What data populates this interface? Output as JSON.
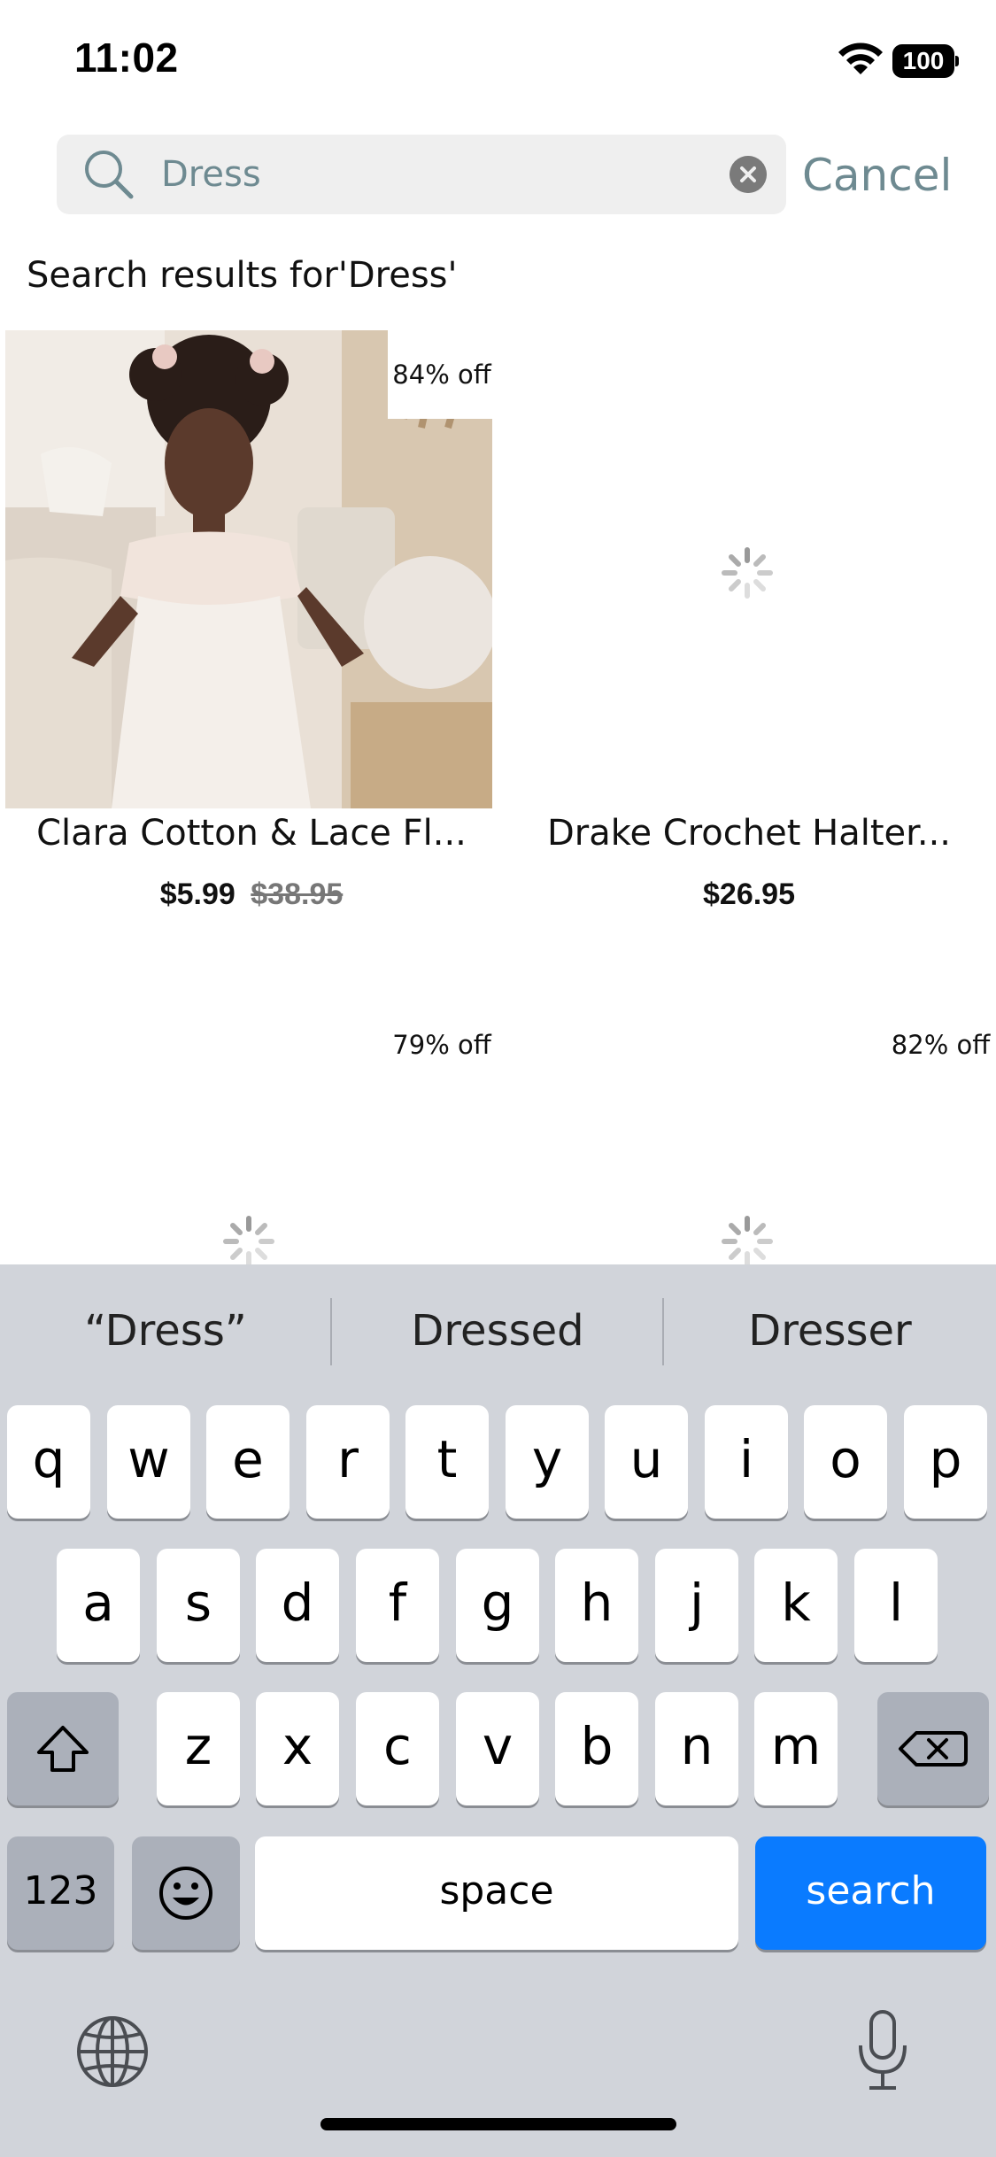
{
  "status_bar": {
    "time": "11:02",
    "battery": "100"
  },
  "search": {
    "query": "Dress",
    "cancel_label": "Cancel"
  },
  "results_heading": "Search results for'Dress'",
  "products": [
    {
      "name": "Clara Cotton & Lace Fl...",
      "price": "$5.99",
      "original_price": "$38.95",
      "discount": "84% off",
      "image_loaded": true
    },
    {
      "name": "Drake Crochet Halter...",
      "price": "$26.95",
      "original_price": "",
      "discount": "",
      "image_loaded": false
    },
    {
      "name": "",
      "price": "",
      "original_price": "",
      "discount": "79% off",
      "image_loaded": false
    },
    {
      "name": "",
      "price": "",
      "original_price": "",
      "discount": "82% off",
      "image_loaded": false
    }
  ],
  "keyboard": {
    "suggestions": [
      "“Dress”",
      "Dressed",
      "Dresser"
    ],
    "row1": [
      "q",
      "w",
      "e",
      "r",
      "t",
      "y",
      "u",
      "i",
      "o",
      "p"
    ],
    "row2": [
      "a",
      "s",
      "d",
      "f",
      "g",
      "h",
      "j",
      "k",
      "l"
    ],
    "row3": [
      "z",
      "x",
      "c",
      "v",
      "b",
      "n",
      "m"
    ],
    "numbers_label": "123",
    "space_label": "space",
    "search_label": "search",
    "action_color": "#0a7bff"
  }
}
